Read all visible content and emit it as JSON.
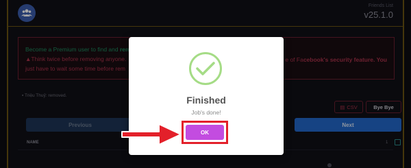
{
  "app": {
    "title": "Friends List",
    "version": "v25.1.0"
  },
  "notice": {
    "line1_pre": "Become a Premium user to find and ",
    "line1_bold": "rem",
    "line2_pre": "Think twice before removing anyone. ",
    "line2_right_pre": "e of Fa",
    "line2_right_bold": "cebook's security feature. You",
    "line3": "just have to wait some time before rem"
  },
  "status": {
    "removed_text": "Triệu Thuỷ: removed."
  },
  "buttons": {
    "csv": "CSV",
    "bye_bye": "Bye Bye",
    "previous": "Previous",
    "next": "Next"
  },
  "table": {
    "column_name": "NAME",
    "selected_count": "1"
  },
  "modal": {
    "title": "Finished",
    "text": "Job's done!",
    "ok_label": "OK"
  },
  "colors": {
    "ok_button": "#c34ce0",
    "highlight_frame": "#e3202a",
    "success_check": "#a5dc86",
    "next_button": "#2367c9"
  }
}
